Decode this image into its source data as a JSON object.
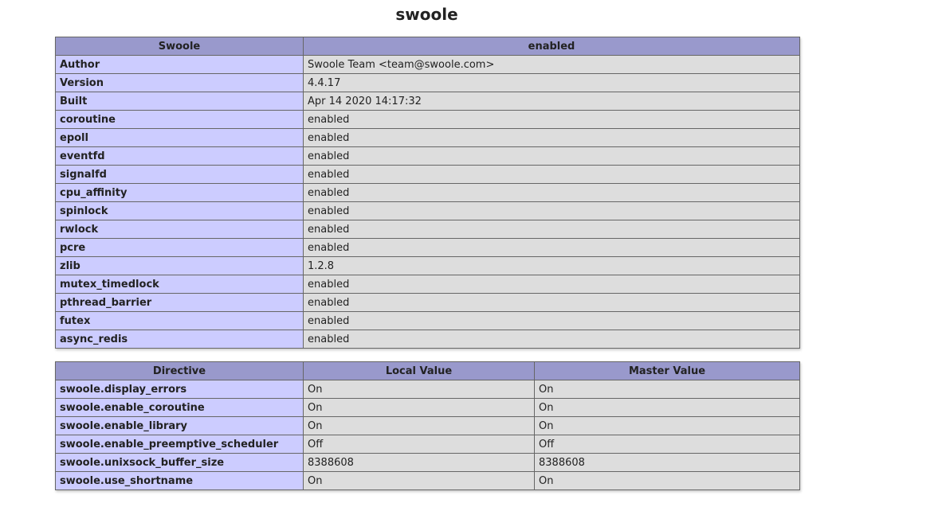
{
  "page": {
    "title": "swoole"
  },
  "info_table": {
    "headers": [
      "Swoole",
      "enabled"
    ],
    "rows": [
      [
        "Author",
        "Swoole Team <team@swoole.com>"
      ],
      [
        "Version",
        "4.4.17"
      ],
      [
        "Built",
        "Apr 14 2020 14:17:32"
      ],
      [
        "coroutine",
        "enabled"
      ],
      [
        "epoll",
        "enabled"
      ],
      [
        "eventfd",
        "enabled"
      ],
      [
        "signalfd",
        "enabled"
      ],
      [
        "cpu_affinity",
        "enabled"
      ],
      [
        "spinlock",
        "enabled"
      ],
      [
        "rwlock",
        "enabled"
      ],
      [
        "pcre",
        "enabled"
      ],
      [
        "zlib",
        "1.2.8"
      ],
      [
        "mutex_timedlock",
        "enabled"
      ],
      [
        "pthread_barrier",
        "enabled"
      ],
      [
        "futex",
        "enabled"
      ],
      [
        "async_redis",
        "enabled"
      ]
    ]
  },
  "directives_table": {
    "headers": [
      "Directive",
      "Local Value",
      "Master Value"
    ],
    "rows": [
      [
        "swoole.display_errors",
        "On",
        "On"
      ],
      [
        "swoole.enable_coroutine",
        "On",
        "On"
      ],
      [
        "swoole.enable_library",
        "On",
        "On"
      ],
      [
        "swoole.enable_preemptive_scheduler",
        "Off",
        "Off"
      ],
      [
        "swoole.unixsock_buffer_size",
        "8388608",
        "8388608"
      ],
      [
        "swoole.use_shortname",
        "On",
        "On"
      ]
    ]
  },
  "colors": {
    "header_bg": "#9999cc",
    "key_cell_bg": "#ccccff",
    "value_cell_bg": "#dddddd",
    "border": "#666666"
  }
}
